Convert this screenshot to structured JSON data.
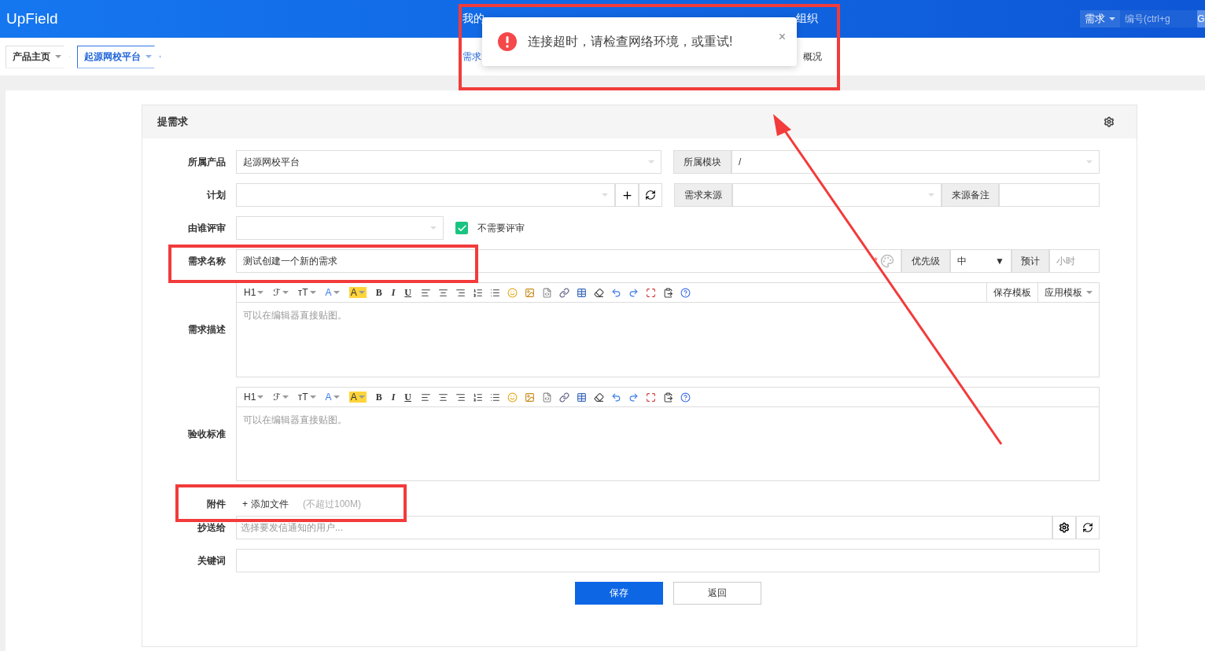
{
  "header": {
    "logo": "UpField",
    "nav": [
      {
        "label": "我的",
        "selected": false
      },
      {
        "label": "组织",
        "selected": false
      }
    ],
    "search": {
      "scope": "需求",
      "placeholder": "编号(ctrl+g",
      "button": "G"
    }
  },
  "subbar": {
    "breadcrumbs": [
      {
        "label": "产品主页",
        "selected": false
      },
      {
        "label": "起源网校平台",
        "selected": true
      }
    ],
    "menu": [
      {
        "label": "需求",
        "selected": true
      },
      {
        "label": "概况",
        "selected": false
      }
    ]
  },
  "toast": {
    "message": "连接超时，请检查网络环境，或重试!",
    "close": "×",
    "highlighted": true
  },
  "form": {
    "title": "提需求",
    "product": {
      "label": "所属产品",
      "value": "起源网校平台"
    },
    "module": {
      "label": "所属模块",
      "value": "/"
    },
    "plan": {
      "label": "计划"
    },
    "source": {
      "label": "需求来源",
      "note_label": "来源备注"
    },
    "reviewer": {
      "label": "由谁评审",
      "skip_label": "不需要评审",
      "skip_checked": true
    },
    "name": {
      "label": "需求名称",
      "value": "测试创建一个新的需求",
      "required": "*",
      "highlighted": true,
      "priority_label": "优先级",
      "priority": "中",
      "priority_arrow": "▼",
      "estimate_label": "预计",
      "estimate_placeholder": "小时"
    },
    "editors": [
      {
        "label": "需求描述",
        "placeholder": "可以在编辑器直接贴图。",
        "templates": [
          "保存模板",
          "应用模板"
        ],
        "toolbar": [
          {
            "kind": "heading",
            "label": "H1",
            "caret": true
          },
          {
            "kind": "font",
            "label": "ℱ",
            "caret": true
          },
          {
            "kind": "size",
            "label": "тT",
            "caret": true
          },
          {
            "kind": "color",
            "label": "A",
            "caret": true
          },
          {
            "kind": "highlight",
            "label": "A",
            "caret": true
          },
          {
            "kind": "bold",
            "label": "B",
            "caret": false
          },
          {
            "kind": "italic",
            "label": "I",
            "caret": false
          },
          {
            "kind": "underline",
            "label": "U",
            "caret": false
          }
        ]
      },
      {
        "label": "验收标准",
        "placeholder": "可以在编辑器直接贴图。",
        "toolbar": [
          {
            "kind": "heading",
            "label": "H1",
            "caret": true
          },
          {
            "kind": "font",
            "label": "ℱ",
            "caret": true
          },
          {
            "kind": "size",
            "label": "тT",
            "caret": true
          },
          {
            "kind": "color",
            "label": "A",
            "caret": true
          },
          {
            "kind": "highlight",
            "label": "A",
            "caret": true
          },
          {
            "kind": "bold",
            "label": "B",
            "caret": false
          },
          {
            "kind": "italic",
            "label": "I",
            "caret": false
          },
          {
            "kind": "underline",
            "label": "U",
            "caret": false
          }
        ]
      }
    ],
    "attachment": {
      "label": "附件",
      "plus": "+",
      "action": "添加文件",
      "limit": "(不超过100M)",
      "highlighted": true
    },
    "cc": {
      "label": "抄送给",
      "placeholder": "选择要发信通知的用户..."
    },
    "keywords": {
      "label": "关键词"
    },
    "buttons": [
      {
        "label": "保存",
        "kind": "primary"
      },
      {
        "label": "返回",
        "kind": "default"
      }
    ]
  },
  "pointer_arrow": true
}
